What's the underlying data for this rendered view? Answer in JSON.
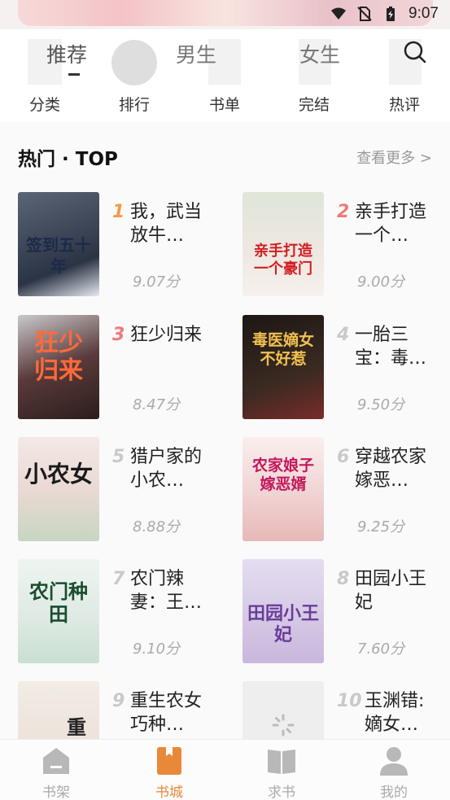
{
  "status_bar": {
    "time": "9:07"
  },
  "tabs": [
    {
      "label": "推荐",
      "active": true
    },
    {
      "label": "男生",
      "active": false
    },
    {
      "label": "女生",
      "active": false
    }
  ],
  "categories": [
    "分类",
    "排行",
    "书单",
    "完结",
    "热评"
  ],
  "section": {
    "title": "热门 · TOP",
    "more_label": "查看更多 >"
  },
  "books": [
    {
      "rank": "1",
      "title": "我，武当放牛…",
      "score": "9.07分",
      "cover_text": "签到五十年",
      "cover_color": "#3b4658"
    },
    {
      "rank": "2",
      "title": "亲手打造一个…",
      "score": "9.00分",
      "cover_text": "亲手打造一个豪门",
      "cover_color": "#e9e1d6"
    },
    {
      "rank": "3",
      "title": "狂少归来",
      "score": "8.47分",
      "cover_text": "狂少归来",
      "cover_color": "#6e4b4a"
    },
    {
      "rank": "4",
      "title": "一胎三宝：毒…",
      "score": "9.50分",
      "cover_text": "毒医嫡女不好惹",
      "cover_color": "#2a2018"
    },
    {
      "rank": "5",
      "title": "猎户家的小农…",
      "score": "8.88分",
      "cover_text": "小农女",
      "cover_color": "#f1ebe8"
    },
    {
      "rank": "6",
      "title": "穿越农家嫁恶…",
      "score": "9.25分",
      "cover_text": "农家娘子嫁恶婿",
      "cover_color": "#f6e8e6"
    },
    {
      "rank": "7",
      "title": "农门辣妻：王…",
      "score": "9.10分",
      "cover_text": "农门种田",
      "cover_color": "#eaf2ee"
    },
    {
      "rank": "8",
      "title": "田园小王妃",
      "score": "7.60分",
      "cover_text": "田园小王妃",
      "cover_color": "#dcd3e9"
    },
    {
      "rank": "9",
      "title": "重生农女巧种…",
      "score": "",
      "cover_text": "重",
      "cover_color": "#f0e6de"
    },
    {
      "rank": "10",
      "title": "玉渊错: 嫡女…",
      "score": "",
      "cover_text": "",
      "cover_color": "#eeeeee"
    }
  ],
  "bottom_nav": [
    {
      "label": "书架",
      "icon": "bookshelf-icon",
      "active": false
    },
    {
      "label": "书城",
      "icon": "bookstore-icon",
      "active": true
    },
    {
      "label": "求书",
      "icon": "request-book-icon",
      "active": false
    },
    {
      "label": "我的",
      "icon": "profile-icon",
      "active": false
    }
  ],
  "colors": {
    "accent": "#e8893a",
    "rank_first": "#f39a4c",
    "rank_second": "#ef7a7a",
    "muted": "#aaaaaa"
  }
}
